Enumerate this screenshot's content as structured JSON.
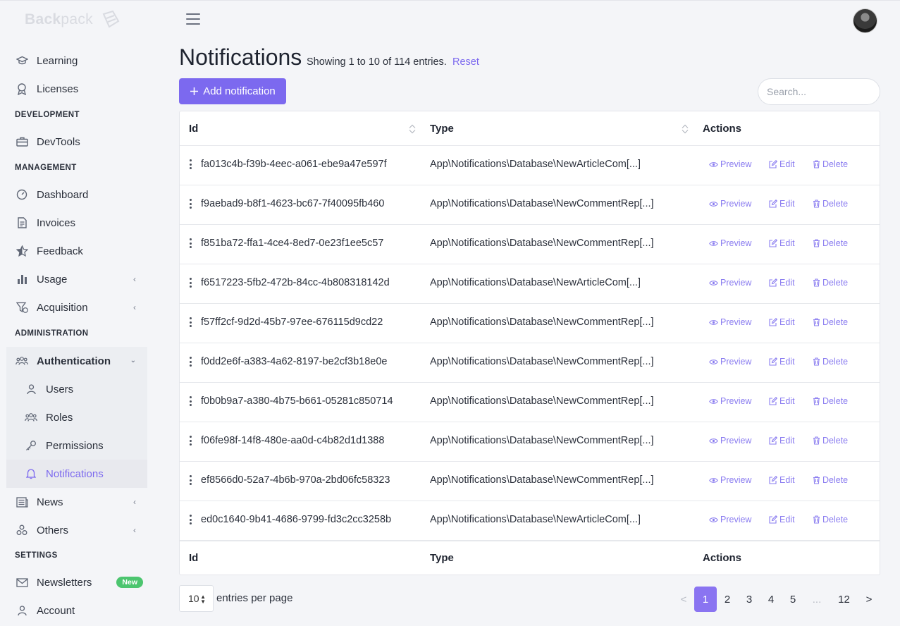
{
  "brand": {
    "bold": "Back",
    "light": "pack"
  },
  "sidebar": {
    "items_top": [
      {
        "label": "Learning",
        "icon": "graduation-cap-icon"
      },
      {
        "label": "Licenses",
        "icon": "award-icon"
      }
    ],
    "sections": {
      "development": "DEVELOPMENT",
      "management": "MANAGEMENT",
      "administration": "ADMINISTRATION",
      "settings": "SETTINGS"
    },
    "devtools": "DevTools",
    "management_items": [
      "Dashboard",
      "Invoices",
      "Feedback",
      "Usage",
      "Acquisition"
    ],
    "authentication": "Authentication",
    "auth_items": [
      "Users",
      "Roles",
      "Permissions",
      "Notifications"
    ],
    "more_items": [
      "News",
      "Others"
    ],
    "settings_items": [
      "Newsletters",
      "Account"
    ],
    "new_badge": "New"
  },
  "page": {
    "title": "Notifications",
    "subtitle": "Showing 1 to 10 of 114 entries.",
    "reset": "Reset",
    "add_button": "Add notification",
    "search_placeholder": "Search..."
  },
  "table": {
    "headers": {
      "id": "Id",
      "type": "Type",
      "actions": "Actions"
    },
    "action_labels": {
      "preview": "Preview",
      "edit": "Edit",
      "delete": "Delete"
    },
    "rows": [
      {
        "id": "fa013c4b-f39b-4eec-a061-ebe9a47e597f",
        "type": "App\\Notifications\\Database\\NewArticleCom[...]"
      },
      {
        "id": "f9aebad9-b8f1-4623-bc67-7f40095fb460",
        "type": "App\\Notifications\\Database\\NewCommentRep[...]"
      },
      {
        "id": "f851ba72-ffa1-4ce4-8ed7-0e23f1ee5c57",
        "type": "App\\Notifications\\Database\\NewCommentRep[...]"
      },
      {
        "id": "f6517223-5fb2-472b-84cc-4b808318142d",
        "type": "App\\Notifications\\Database\\NewArticleCom[...]"
      },
      {
        "id": "f57ff2cf-9d2d-45b7-97ee-676115d9cd22",
        "type": "App\\Notifications\\Database\\NewCommentRep[...]"
      },
      {
        "id": "f0dd2e6f-a383-4a62-8197-be2cf3b18e0e",
        "type": "App\\Notifications\\Database\\NewCommentRep[...]"
      },
      {
        "id": "f0b0b9a7-a380-4b75-b661-05281c850714",
        "type": "App\\Notifications\\Database\\NewCommentRep[...]"
      },
      {
        "id": "f06fe98f-14f8-480e-aa0d-c4b82d1d1388",
        "type": "App\\Notifications\\Database\\NewCommentRep[...]"
      },
      {
        "id": "ef8566d0-52a7-4b6b-970a-2bd06fc58323",
        "type": "App\\Notifications\\Database\\NewCommentRep[...]"
      },
      {
        "id": "ed0c1640-9b41-4686-9799-fd3c2cc3258b",
        "type": "App\\Notifications\\Database\\NewArticleCom[...]"
      }
    ]
  },
  "footer": {
    "per_page_value": "10",
    "per_page_label": "entries per page",
    "pagination": [
      "<",
      "1",
      "2",
      "3",
      "4",
      "5",
      "...",
      "12",
      ">"
    ],
    "current_page": "1"
  },
  "colors": {
    "accent": "#7c69ef",
    "badge": "#4cc56f"
  }
}
